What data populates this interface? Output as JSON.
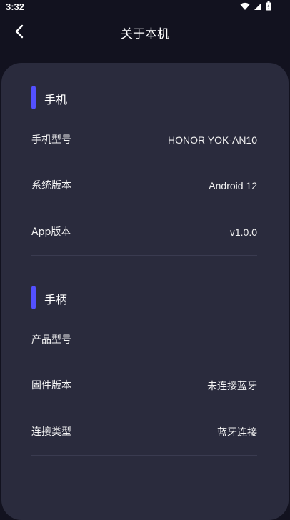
{
  "status_bar": {
    "time": "3:32",
    "icons": [
      "wifi-icon",
      "signal-icon",
      "battery-icon"
    ]
  },
  "header": {
    "back_icon": "chevron-left-icon",
    "title": "关于本机"
  },
  "colors": {
    "background": "#12121f",
    "card": "#2a2b3d",
    "accent": "#5350ff",
    "divider": "#3a3b50"
  },
  "sections": {
    "phone": {
      "title": "手机",
      "rows": [
        {
          "label": "手机型号",
          "value": "HONOR  YOK-AN10"
        },
        {
          "label": "系统版本",
          "value": "Android  12"
        },
        {
          "label": "App版本",
          "value": "v1.0.0"
        }
      ]
    },
    "controller": {
      "title": "手柄",
      "rows": [
        {
          "label": "产品型号",
          "value": ""
        },
        {
          "label": "固件版本",
          "value": "未连接蓝牙"
        },
        {
          "label": "连接类型",
          "value": "蓝牙连接"
        }
      ]
    }
  }
}
